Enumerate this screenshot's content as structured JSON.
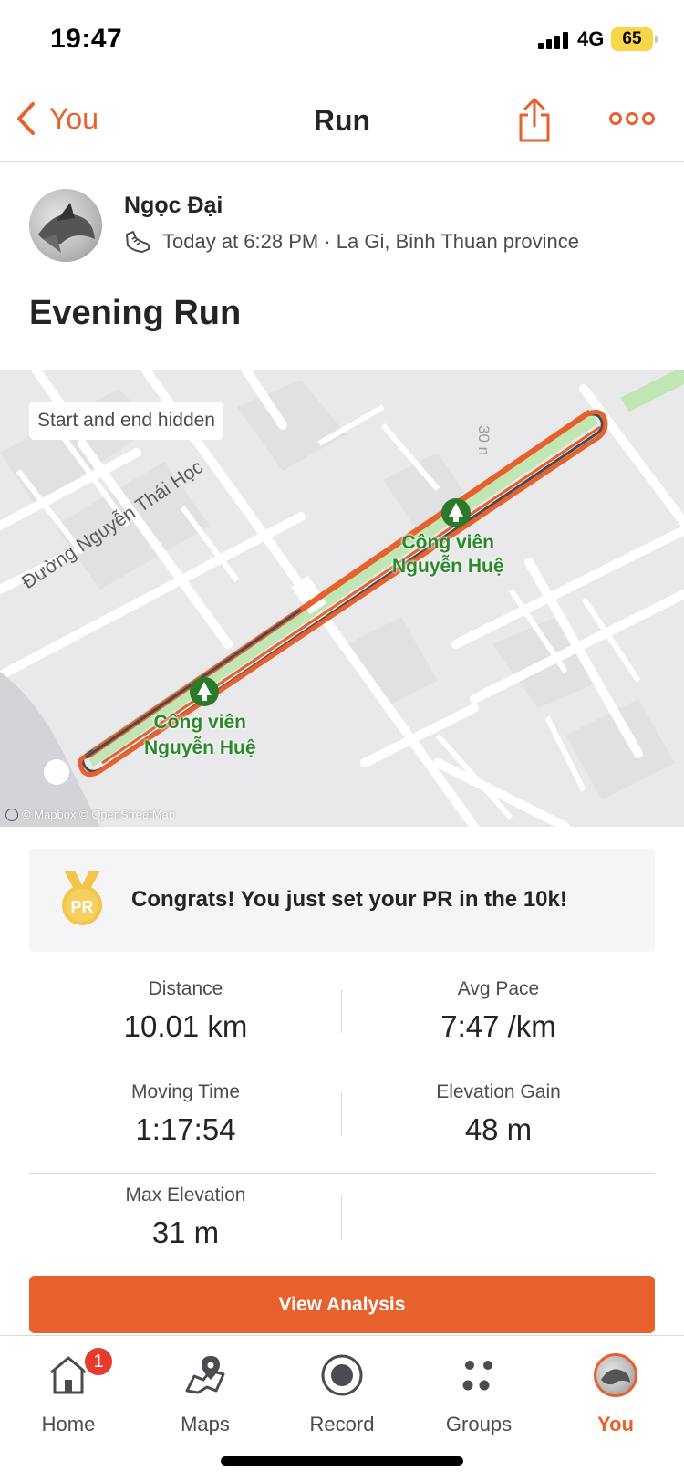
{
  "status_bar": {
    "time": "19:47",
    "network": "4G",
    "battery": "65"
  },
  "nav": {
    "back_label": "You",
    "title": "Run"
  },
  "athlete": {
    "name": "Ngọc Đại",
    "meta": "Today at 6:28 PM · La Gi, Binh Thuan province"
  },
  "activity": {
    "title": "Evening Run"
  },
  "map": {
    "privacy_chip": "Start and end hidden",
    "labels": {
      "street": "Đường Nguyễn Thái Học",
      "park_upper": [
        "Công viên",
        "Nguyễn Huệ"
      ],
      "park_lower": [
        "Công viên",
        "Nguyễn Huệ"
      ],
      "road_marker": "30 n"
    },
    "attribution": "© Mapbox © OpenStreetMap",
    "route_color": "#e8602c",
    "park_color": "#bfe6b3"
  },
  "pr_banner": {
    "text": "Congrats! You just set your PR in the 10k!",
    "medal_label": "PR"
  },
  "stats": [
    [
      {
        "label": "Distance",
        "value": "10.01 km"
      },
      {
        "label": "Avg Pace",
        "value": "7:47 /km"
      }
    ],
    [
      {
        "label": "Moving Time",
        "value": "1:17:54"
      },
      {
        "label": "Elevation Gain",
        "value": "48 m"
      }
    ],
    [
      {
        "label": "Max Elevation",
        "value": "31 m"
      }
    ]
  ],
  "actions": {
    "view_analysis": "View Analysis"
  },
  "tabbar": {
    "items": [
      {
        "label": "Home",
        "icon": "home-icon",
        "badge": "1"
      },
      {
        "label": "Maps",
        "icon": "maps-icon"
      },
      {
        "label": "Record",
        "icon": "record-icon"
      },
      {
        "label": "Groups",
        "icon": "groups-icon"
      },
      {
        "label": "You",
        "icon": "avatar"
      }
    ],
    "active": "You"
  },
  "colors": {
    "accent": "#e8602c",
    "text": "#242428",
    "muted": "#4b4b50"
  }
}
